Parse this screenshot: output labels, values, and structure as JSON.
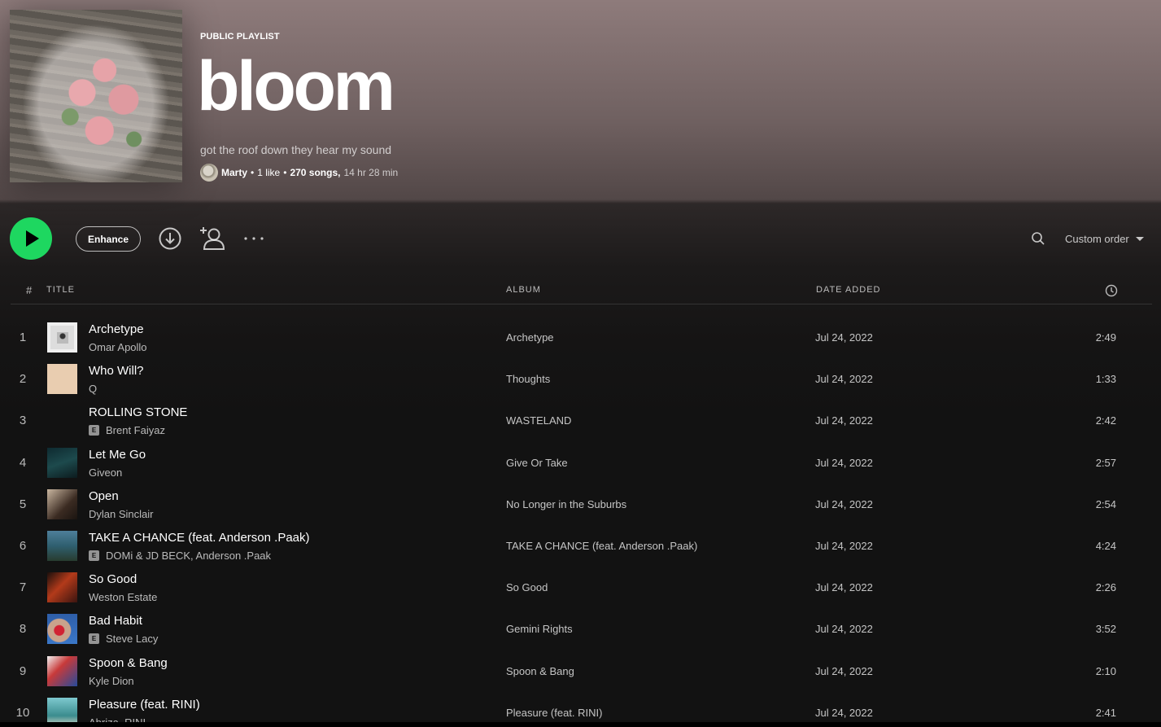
{
  "playlist": {
    "type_label": "PUBLIC PLAYLIST",
    "title": "bloom",
    "description": "got the roof down they hear my sound",
    "owner": "Marty",
    "likes": "1 like",
    "songs": "270 songs,",
    "duration": "14 hr 28 min",
    "separator": "•"
  },
  "actions": {
    "enhance_label": "Enhance",
    "sort_label": "Custom order",
    "more_label": "···"
  },
  "table": {
    "headers": {
      "num": "#",
      "title": "TITLE",
      "album": "ALBUM",
      "date": "DATE ADDED"
    },
    "rows": [
      {
        "num": "1",
        "title": "Archetype",
        "artist": "Omar Apollo",
        "explicit": false,
        "album": "Archetype",
        "date": "Jul 24, 2022",
        "duration": "2:49"
      },
      {
        "num": "2",
        "title": "Who Will?",
        "artist": "Q",
        "explicit": false,
        "album": "Thoughts",
        "date": "Jul 24, 2022",
        "duration": "1:33"
      },
      {
        "num": "3",
        "title": "ROLLING STONE",
        "artist": "Brent Faiyaz",
        "explicit": true,
        "album": "WASTELAND",
        "date": "Jul 24, 2022",
        "duration": "2:42"
      },
      {
        "num": "4",
        "title": "Let Me Go",
        "artist": "Giveon",
        "explicit": false,
        "album": "Give Or Take",
        "date": "Jul 24, 2022",
        "duration": "2:57"
      },
      {
        "num": "5",
        "title": "Open",
        "artist": "Dylan Sinclair",
        "explicit": false,
        "album": "No Longer in the Suburbs",
        "date": "Jul 24, 2022",
        "duration": "2:54"
      },
      {
        "num": "6",
        "title": "TAKE A CHANCE (feat. Anderson .Paak)",
        "artist": "DOMi & JD BECK, Anderson .Paak",
        "explicit": true,
        "album": "TAKE A CHANCE (feat. Anderson .Paak)",
        "date": "Jul 24, 2022",
        "duration": "4:24"
      },
      {
        "num": "7",
        "title": "So Good",
        "artist": "Weston Estate",
        "explicit": false,
        "album": "So Good",
        "date": "Jul 24, 2022",
        "duration": "2:26"
      },
      {
        "num": "8",
        "title": "Bad Habit",
        "artist": "Steve Lacy",
        "explicit": true,
        "album": "Gemini Rights",
        "date": "Jul 24, 2022",
        "duration": "3:52"
      },
      {
        "num": "9",
        "title": "Spoon & Bang",
        "artist": "Kyle Dion",
        "explicit": false,
        "album": "Spoon & Bang",
        "date": "Jul 24, 2022",
        "duration": "2:10"
      },
      {
        "num": "10",
        "title": "Pleasure (feat. RINI)",
        "artist": "Abriza, RINI",
        "explicit": false,
        "album": "Pleasure (feat. RINI)",
        "date": "Jul 24, 2022",
        "duration": "2:41"
      }
    ]
  },
  "explicit_badge": "E",
  "colors": {
    "accent_green": "#1ed760",
    "header_top": "#8e7b7b",
    "background": "#121212"
  },
  "icons": [
    "play-icon",
    "download-icon",
    "add-user-icon",
    "more-icon",
    "search-icon",
    "chevron-down-icon",
    "clock-icon"
  ]
}
